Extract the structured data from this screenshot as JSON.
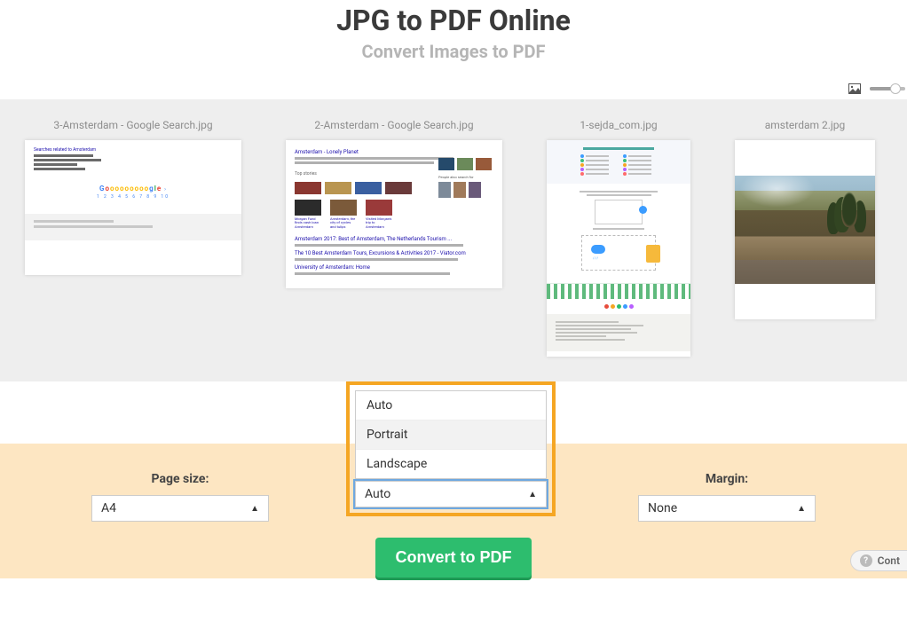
{
  "header": {
    "title": "JPG to PDF Online",
    "subtitle": "Convert Images to PDF"
  },
  "zoom": {
    "value": 72,
    "max": 100
  },
  "thumbnails": {
    "items": [
      {
        "label": "3-Amsterdam - Google Search.jpg"
      },
      {
        "label": "2-Amsterdam - Google Search.jpg"
      },
      {
        "label": "1-sejda_com.jpg"
      },
      {
        "label": "amsterdam 2.jpg"
      }
    ]
  },
  "options": {
    "page_size": {
      "label": "Page size:",
      "value": "A4"
    },
    "orientation": {
      "menu": {
        "option_auto": "Auto",
        "option_portrait": "Portrait",
        "option_landscape": "Landscape"
      },
      "selected": "Auto"
    },
    "margin": {
      "label": "Margin:",
      "value": "None"
    }
  },
  "actions": {
    "convert_label": "Convert to PDF",
    "contact_label": "Cont"
  },
  "glyphs": {
    "question": "?",
    "caret": "▲"
  },
  "colors": {
    "accent_orange": "#f5a623",
    "convert_green": "#2dbd6e",
    "options_bg": "#fde6c2",
    "focus_blue": "#6ea8e0"
  }
}
